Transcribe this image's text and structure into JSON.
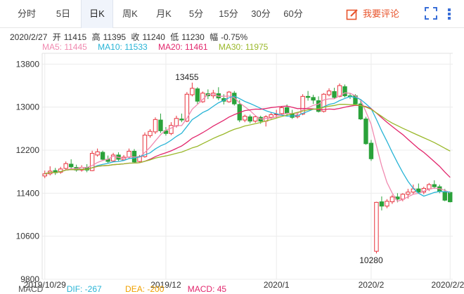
{
  "tabs": [
    {
      "label": "分时",
      "active": false
    },
    {
      "label": "5日",
      "active": false
    },
    {
      "label": "日K",
      "active": true
    },
    {
      "label": "周K",
      "active": false
    },
    {
      "label": "月K",
      "active": false
    },
    {
      "label": "5分",
      "active": false
    },
    {
      "label": "15分",
      "active": false
    },
    {
      "label": "30分",
      "active": false
    },
    {
      "label": "60分",
      "active": false
    }
  ],
  "comment_button": "我要评论",
  "quote": {
    "date": "2020/2/27",
    "open_label": "开",
    "open": "11415",
    "high_label": "高",
    "high": "11395",
    "close_label": "收",
    "close": "11240",
    "low_label": "低",
    "low": "11230",
    "change_label": "幅",
    "change": "-0.75%"
  },
  "ma": [
    {
      "label": "MA5: 11445",
      "color": "#f08ab0"
    },
    {
      "label": "MA10: 11533",
      "color": "#28b4d6"
    },
    {
      "label": "MA20: 11461",
      "color": "#e2266c"
    },
    {
      "label": "MA30: 11975",
      "color": "#9ab82a"
    }
  ],
  "macd": [
    {
      "label": "MACD",
      "color": "#555555"
    },
    {
      "label": "DIF: -267",
      "color": "#28b4d6"
    },
    {
      "label": "DEA: -200",
      "color": "#f0a000"
    },
    {
      "label": "MACD: 45",
      "color": "#e2266c"
    }
  ],
  "colors": {
    "up": "#e8323c",
    "down": "#2aa23a",
    "grid": "#ececec",
    "axis": "#333333"
  },
  "chart_data": {
    "type": "candlestick",
    "ylim": [
      9800,
      14000
    ],
    "yticks": [
      9800,
      10600,
      11400,
      12200,
      13000,
      13800
    ],
    "xticks": [
      {
        "index": 0,
        "label": "2019/10/29"
      },
      {
        "index": 23,
        "label": "2019/12"
      },
      {
        "index": 44,
        "label": "2020/1"
      },
      {
        "index": 62,
        "label": "2020/2"
      },
      {
        "index": 77,
        "label": "2020/2/27"
      }
    ],
    "annotations": [
      {
        "index": 27,
        "value": 13455,
        "label": "13455"
      },
      {
        "index": 62,
        "value": 10280,
        "label": "10280"
      }
    ],
    "candles": [
      [
        11720,
        11820,
        11760,
        11680
      ],
      [
        11760,
        11900,
        11810,
        11730
      ],
      [
        11820,
        11870,
        11780,
        11740
      ],
      [
        11790,
        11890,
        11850,
        11760
      ],
      [
        11860,
        11990,
        11950,
        11830
      ],
      [
        11940,
        12030,
        11890,
        11850
      ],
      [
        11880,
        11930,
        11830,
        11800
      ],
      [
        11830,
        11920,
        11880,
        11800
      ],
      [
        11880,
        11940,
        11830,
        11790
      ],
      [
        11820,
        12190,
        12140,
        11810
      ],
      [
        12110,
        12230,
        12170,
        12080
      ],
      [
        12160,
        12190,
        12030,
        12000
      ],
      [
        12030,
        12100,
        11990,
        11960
      ],
      [
        12000,
        12150,
        12110,
        11990
      ],
      [
        12110,
        12160,
        12030,
        12000
      ],
      [
        12020,
        12110,
        12070,
        12000
      ],
      [
        12070,
        12230,
        12180,
        12050
      ],
      [
        12180,
        12220,
        11980,
        11960
      ],
      [
        11990,
        12110,
        12080,
        11960
      ],
      [
        12080,
        12530,
        12480,
        12060
      ],
      [
        12470,
        12590,
        12550,
        12430
      ],
      [
        12540,
        12810,
        12770,
        12500
      ],
      [
        12760,
        12880,
        12560,
        12520
      ],
      [
        12560,
        12630,
        12510,
        12470
      ],
      [
        12510,
        12720,
        12660,
        12480
      ],
      [
        12650,
        12840,
        12790,
        12620
      ],
      [
        12780,
        12880,
        12760,
        12720
      ],
      [
        12740,
        13280,
        13240,
        12720
      ],
      [
        13230,
        13455,
        13350,
        13200
      ],
      [
        13340,
        13370,
        13110,
        13060
      ],
      [
        13100,
        13290,
        13260,
        13080
      ],
      [
        13250,
        13330,
        13210,
        13150
      ],
      [
        13210,
        13320,
        13260,
        13160
      ],
      [
        13250,
        13370,
        13170,
        13130
      ],
      [
        13160,
        13240,
        13110,
        13050
      ],
      [
        13100,
        13300,
        13280,
        13080
      ],
      [
        13260,
        13300,
        13060,
        13030
      ],
      [
        13050,
        13130,
        12760,
        12720
      ],
      [
        12760,
        12860,
        12830,
        12720
      ],
      [
        12820,
        12860,
        12740,
        12700
      ],
      [
        12740,
        12850,
        12820,
        12710
      ],
      [
        12810,
        12840,
        12740,
        12690
      ],
      [
        12740,
        12850,
        12820,
        12640
      ],
      [
        12810,
        12900,
        12860,
        12780
      ],
      [
        12860,
        12950,
        12870,
        12800
      ],
      [
        12880,
        13020,
        12990,
        12850
      ],
      [
        12990,
        13050,
        12890,
        12840
      ],
      [
        12880,
        12950,
        12810,
        12780
      ],
      [
        12820,
        12900,
        12850,
        12790
      ],
      [
        12870,
        13240,
        13200,
        12850
      ],
      [
        13200,
        13300,
        13180,
        13120
      ],
      [
        13180,
        13230,
        13130,
        13060
      ],
      [
        13120,
        13200,
        12920,
        12900
      ],
      [
        12920,
        13260,
        13240,
        12900
      ],
      [
        13230,
        13350,
        13300,
        13200
      ],
      [
        13290,
        13360,
        13180,
        13150
      ],
      [
        13200,
        13440,
        13400,
        13180
      ],
      [
        13380,
        13420,
        13210,
        13180
      ],
      [
        13210,
        13260,
        13200,
        13150
      ],
      [
        13210,
        13240,
        13060,
        13040
      ],
      [
        13060,
        13120,
        12780,
        12760
      ],
      [
        12780,
        12820,
        12320,
        12300
      ],
      [
        12330,
        12390,
        12040,
        12000
      ],
      [
        10320,
        11240,
        11230,
        10280
      ],
      [
        11240,
        11340,
        11160,
        11080
      ],
      [
        11160,
        11290,
        11250,
        11120
      ],
      [
        11240,
        11370,
        11330,
        11200
      ],
      [
        11330,
        11400,
        11290,
        11230
      ],
      [
        11290,
        11400,
        11380,
        11250
      ],
      [
        11380,
        11480,
        11420,
        11300
      ],
      [
        11420,
        11560,
        11480,
        11380
      ],
      [
        11480,
        11580,
        11420,
        11390
      ],
      [
        11420,
        11520,
        11490,
        11380
      ],
      [
        11480,
        11590,
        11560,
        11440
      ],
      [
        11560,
        11640,
        11520,
        11480
      ],
      [
        11520,
        11560,
        11430,
        11400
      ],
      [
        11430,
        11480,
        11270,
        11250
      ],
      [
        11415,
        11395,
        11240,
        11230
      ]
    ]
  }
}
